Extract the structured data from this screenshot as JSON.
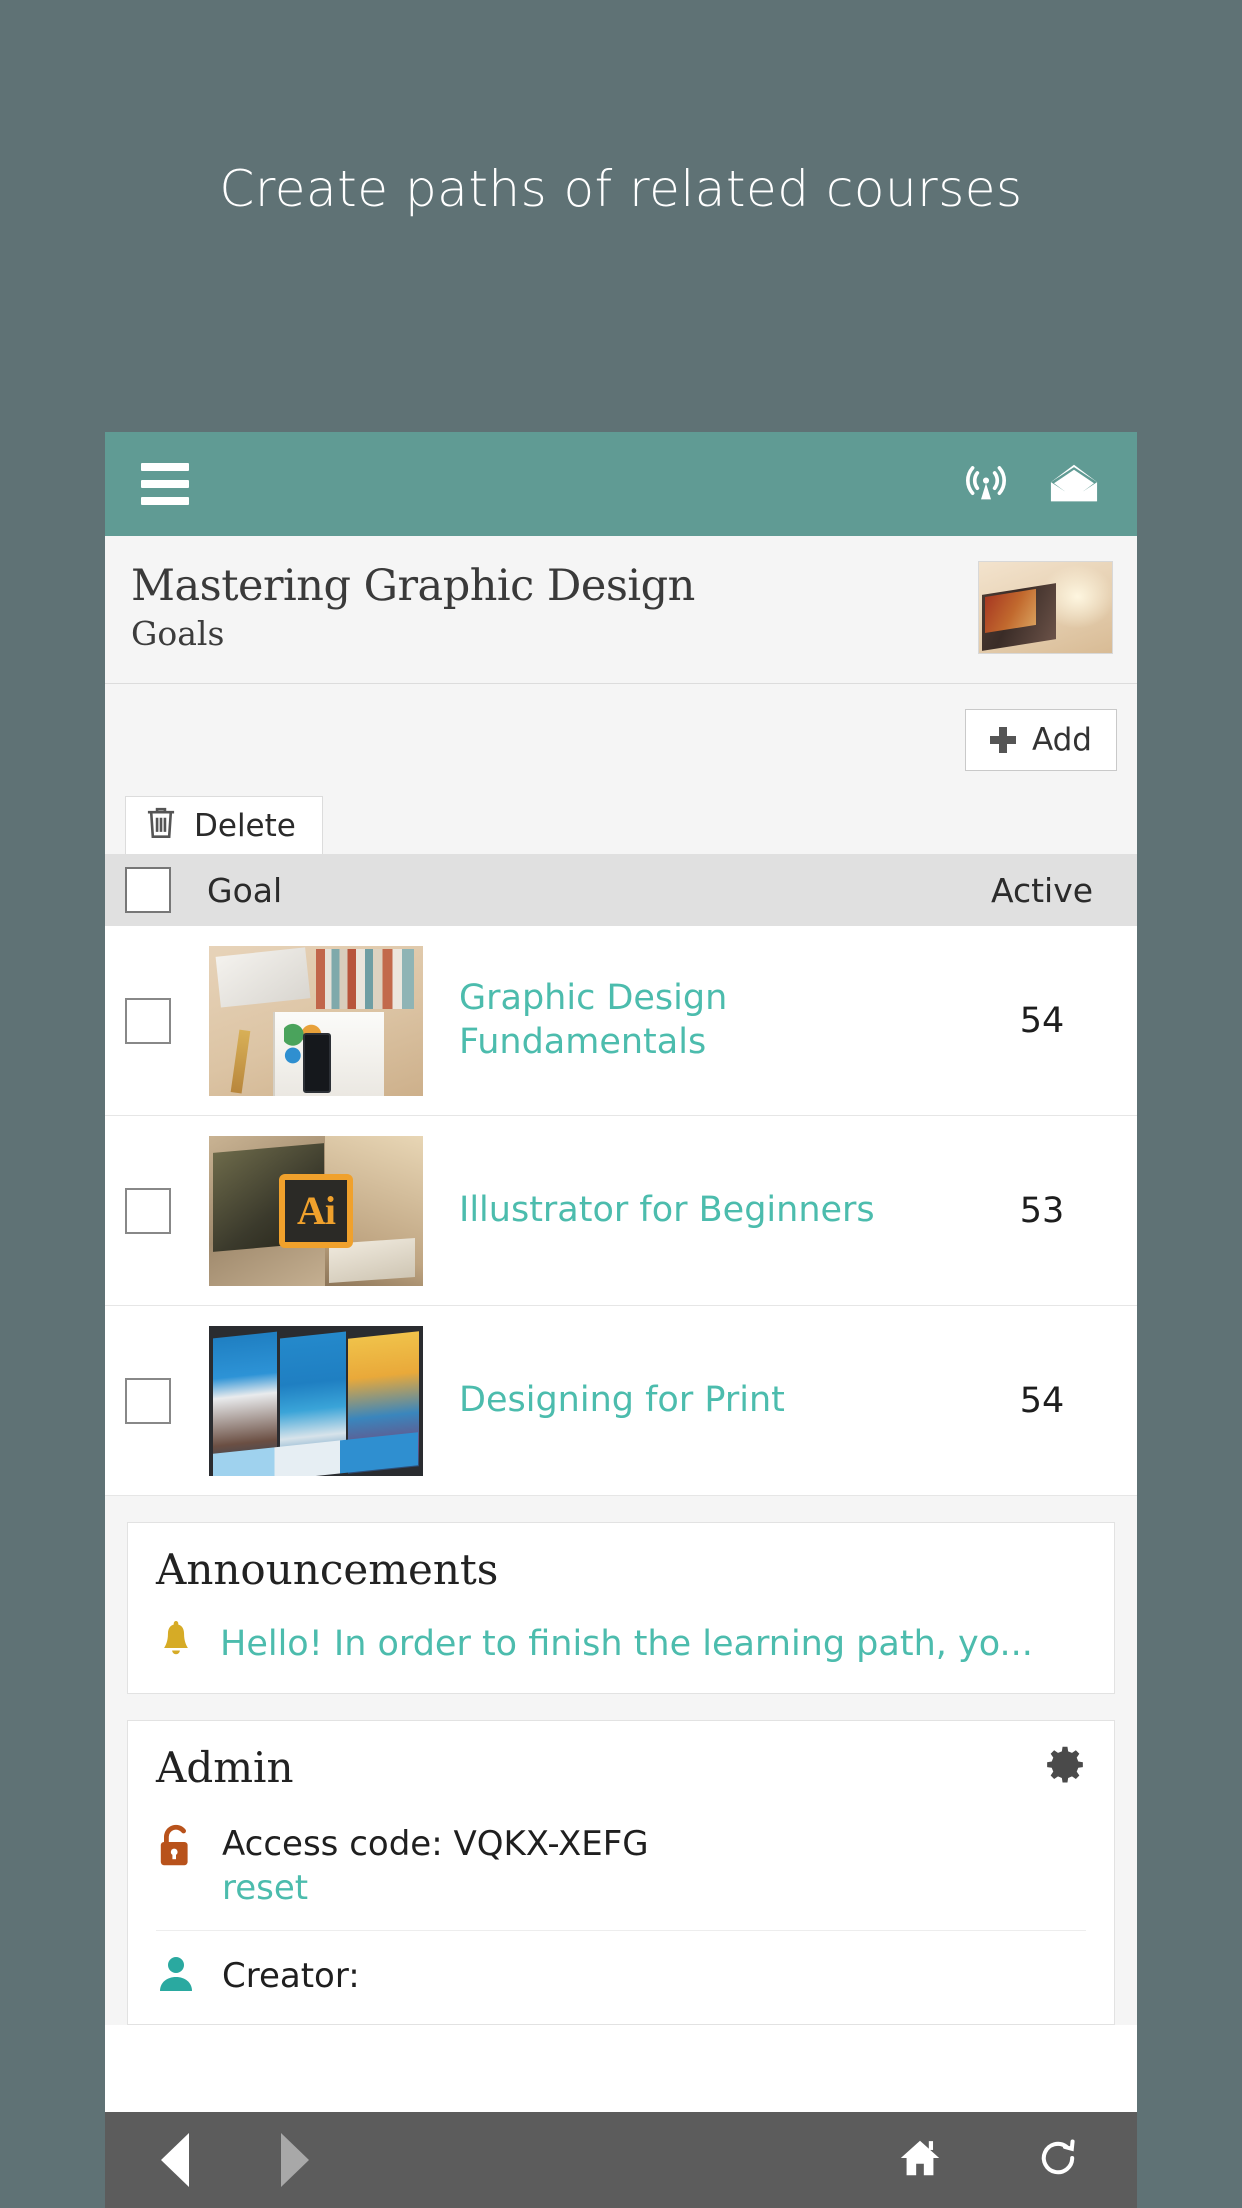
{
  "promo": {
    "headline": "Create paths of related courses"
  },
  "appbar": {
    "menu_icon": "hamburger-menu-icon",
    "broadcast_icon": "broadcast-icon",
    "mail_icon": "envelope-icon"
  },
  "course": {
    "title": "Mastering Graphic Design",
    "subtitle": "Goals",
    "thumbnail_alt": "laptop-with-stylus-photo"
  },
  "toolbar": {
    "add_label": "Add",
    "add_icon": "plus-icon",
    "delete_label": "Delete",
    "delete_icon": "trash-icon"
  },
  "table": {
    "columns": {
      "select": "",
      "goal": "Goal",
      "active": "Active"
    },
    "rows": [
      {
        "title": "Graphic Design Fundamentals",
        "active": "54",
        "thumbnail_alt": "desk-with-books-and-magazine-photo"
      },
      {
        "title": "Illustrator for Beginners",
        "active": "53",
        "thumbnail_alt": "adobe-illustrator-logo-on-desk-photo",
        "badge": "Ai"
      },
      {
        "title": "Designing for Print",
        "active": "54",
        "thumbnail_alt": "blue-trifold-brochure-photo"
      }
    ]
  },
  "announcements": {
    "title": "Announcements",
    "icon": "bell-icon",
    "item": "Hello! In order to finish the learning path, yo..."
  },
  "admin": {
    "title": "Admin",
    "settings_icon": "gear-icon",
    "lock_icon": "unlocked-padlock-icon",
    "access_code": "Access code: VQKX-XEFG",
    "reset_label": "reset",
    "creator_label": "Creator:",
    "creator_icon": "person-icon"
  },
  "bottom_nav": {
    "back_icon": "back-arrow-icon",
    "forward_icon": "forward-arrow-icon",
    "home_icon": "home-icon",
    "refresh_icon": "refresh-icon"
  },
  "colors": {
    "page_background": "#5f7275",
    "appbar_teal": "#609b94",
    "link_teal": "#4cbcad",
    "bell_yellow": "#d6ab26",
    "lock_orange": "#b8521b",
    "nav_gray": "#5c5c5c"
  }
}
